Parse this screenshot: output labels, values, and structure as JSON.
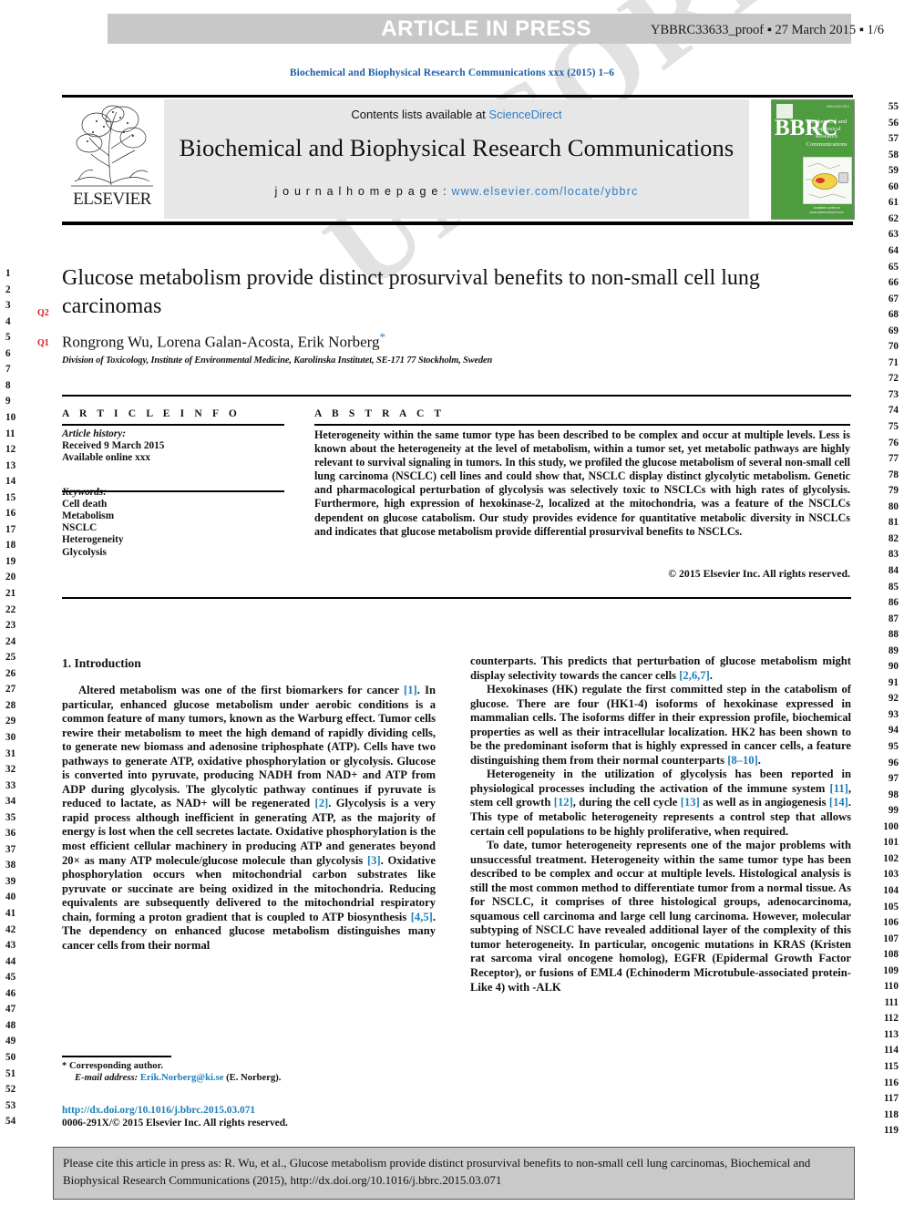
{
  "header": {
    "article_in_press": "ARTICLE IN PRESS",
    "proof_info": "YBBRC33633_proof ▪ 27 March 2015 ▪ 1/6"
  },
  "running_head": "Biochemical and Biophysical Research Communications xxx (2015) 1–6",
  "masthead": {
    "publisher_name": "ELSEVIER",
    "contents_prefix": "Contents lists available at ",
    "contents_link": "ScienceDirect",
    "journal_title": "Biochemical and Biophysical Research Communications",
    "homepage_prefix": "j o u r n a l   h o m e p a g e :  ",
    "homepage_url": "www.elsevier.com/locate/ybbrc",
    "cover": {
      "acronym": "BBRC",
      "title_lines": "Biochemical and Biophysical Research Communications",
      "footer": "Available online at www.sciencedirect.com"
    }
  },
  "article": {
    "query_marks": {
      "q2": "Q2",
      "q1": "Q1"
    },
    "title": "Glucose metabolism provide distinct prosurvival benefits to non-small cell lung carcinomas",
    "authors": "Rongrong Wu, Lorena Galan-Acosta, Erik Norberg",
    "corresponding_star": "*",
    "affiliation": "Division of Toxicology, Institute of Environmental Medicine, Karolinska Institutet, SE-171 77 Stockholm, Sweden"
  },
  "article_info": {
    "heading": "A R T I C L E   I N F O",
    "history_label": "Article history:",
    "received": "Received 9 March 2015",
    "available": "Available online xxx",
    "keywords_label": "Keywords:",
    "keywords": [
      "Cell death",
      "Metabolism",
      "NSCLC",
      "Heterogeneity",
      "Glycolysis"
    ]
  },
  "abstract": {
    "heading": "A B S T R A C T",
    "text": "Heterogeneity within the same tumor type has been described to be complex and occur at multiple levels. Less is known about the heterogeneity at the level of metabolism, within a tumor set, yet metabolic pathways are highly relevant to survival signaling in tumors. In this study, we profiled the glucose metabolism of several non-small cell lung carcinoma (NSCLC) cell lines and could show that, NSCLC display distinct glycolytic metabolism. Genetic and pharmacological perturbation of glycolysis was selectively toxic to NSCLCs with high rates of glycolysis. Furthermore, high expression of hexokinase-2, localized at the mitochondria, was a feature of the NSCLCs dependent on glucose catabolism. Our study provides evidence for quantitative metabolic diversity in NSCLCs and indicates that glucose metabolism provide differential prosurvival benefits to NSCLCs.",
    "copyright": "© 2015 Elsevier Inc. All rights reserved."
  },
  "body": {
    "section_heading": "1.  Introduction",
    "left_paragraphs": [
      "Altered metabolism was one of the first biomarkers for cancer [1]. In particular, enhanced glucose metabolism under aerobic conditions is a common feature of many tumors, known as the Warburg effect. Tumor cells rewire their metabolism to meet the high demand of rapidly dividing cells, to generate new biomass and adenosine triphosphate (ATP). Cells have two pathways to generate ATP, oxidative phosphorylation or glycolysis. Glucose is converted into pyruvate, producing NADH from NAD+ and ATP from ADP during glycolysis. The glycolytic pathway continues if pyruvate is reduced to lactate, as NAD+ will be regenerated [2]. Glycolysis is a very rapid process although inefficient in generating ATP, as the majority of energy is lost when the cell secretes lactate. Oxidative phosphorylation is the most efficient cellular machinery in producing ATP and generates beyond 20× as many ATP molecule/glucose molecule than glycolysis [3]. Oxidative phosphorylation occurs when mitochondrial carbon substrates like pyruvate or succinate are being oxidized in the mitochondria. Reducing equivalents are subsequently delivered to the mitochondrial respiratory chain, forming a proton gradient that is coupled to ATP biosynthesis [4,5]. The dependency on enhanced glucose metabolism distinguishes many cancer cells from their normal"
    ],
    "right_paragraphs": [
      "counterparts. This predicts that perturbation of glucose metabolism might display selectivity towards the cancer cells [2,6,7].",
      "Hexokinases (HK) regulate the first committed step in the catabolism of glucose. There are four (HK1-4) isoforms of hexokinase expressed in mammalian cells. The isoforms differ in their expression profile, biochemical properties as well as their intracellular localization. HK2 has been shown to be the predominant isoform that is highly expressed in cancer cells, a feature distinguishing them from their normal counterparts [8–10].",
      "Heterogeneity in the utilization of glycolysis has been reported in physiological processes including the activation of the immune system [11], stem cell growth [12], during the cell cycle [13] as well as in angiogenesis [14]. This type of metabolic heterogeneity represents a control step that allows certain cell populations to be highly proliferative, when required.",
      "To date, tumor heterogeneity represents one of the major problems with unsuccessful treatment. Heterogeneity within the same tumor type has been described to be complex and occur at multiple levels. Histological analysis is still the most common method to differentiate tumor from a normal tissue. As for NSCLC, it comprises of three histological groups, adenocarcinoma, squamous cell carcinoma and large cell lung carcinoma. However, molecular subtyping of NSCLC have revealed additional layer of the complexity of this tumor heterogeneity. In particular, oncogenic mutations in KRAS (Kristen rat sarcoma viral oncogene homolog), EGFR (Epidermal Growth Factor Receptor), or fusions of EML4 (Echinoderm Microtubule-associated protein-Like 4) with -ALK"
    ]
  },
  "footnote": {
    "corresponding": "* Corresponding author.",
    "email_label": "E-mail address:",
    "email": "Erik.Norberg@ki.se",
    "email_suffix": "(E. Norberg).",
    "doi": "http://dx.doi.org/10.1016/j.bbrc.2015.03.071",
    "issn_line": "0006-291X/© 2015 Elsevier Inc. All rights reserved."
  },
  "cite_box": {
    "text": "Please cite this article in press as: R. Wu, et al., Glucose metabolism provide distinct prosurvival benefits to non-small cell lung carcinomas, Biochemical and Biophysical Research Communications (2015), http://dx.doi.org/10.1016/j.bbrc.2015.03.071"
  },
  "line_numbers": {
    "left_start": 1,
    "left_end": 54,
    "right_start": 55,
    "right_end": 119
  },
  "colors": {
    "link": "#1b7fb8",
    "header_band": "#c8c8c8",
    "masthead_band": "#e7e7e7",
    "query_red": "#d21d1d",
    "cover_green": "#4e9c3f"
  },
  "watermark_text": "UNCORRECTED PROOF"
}
